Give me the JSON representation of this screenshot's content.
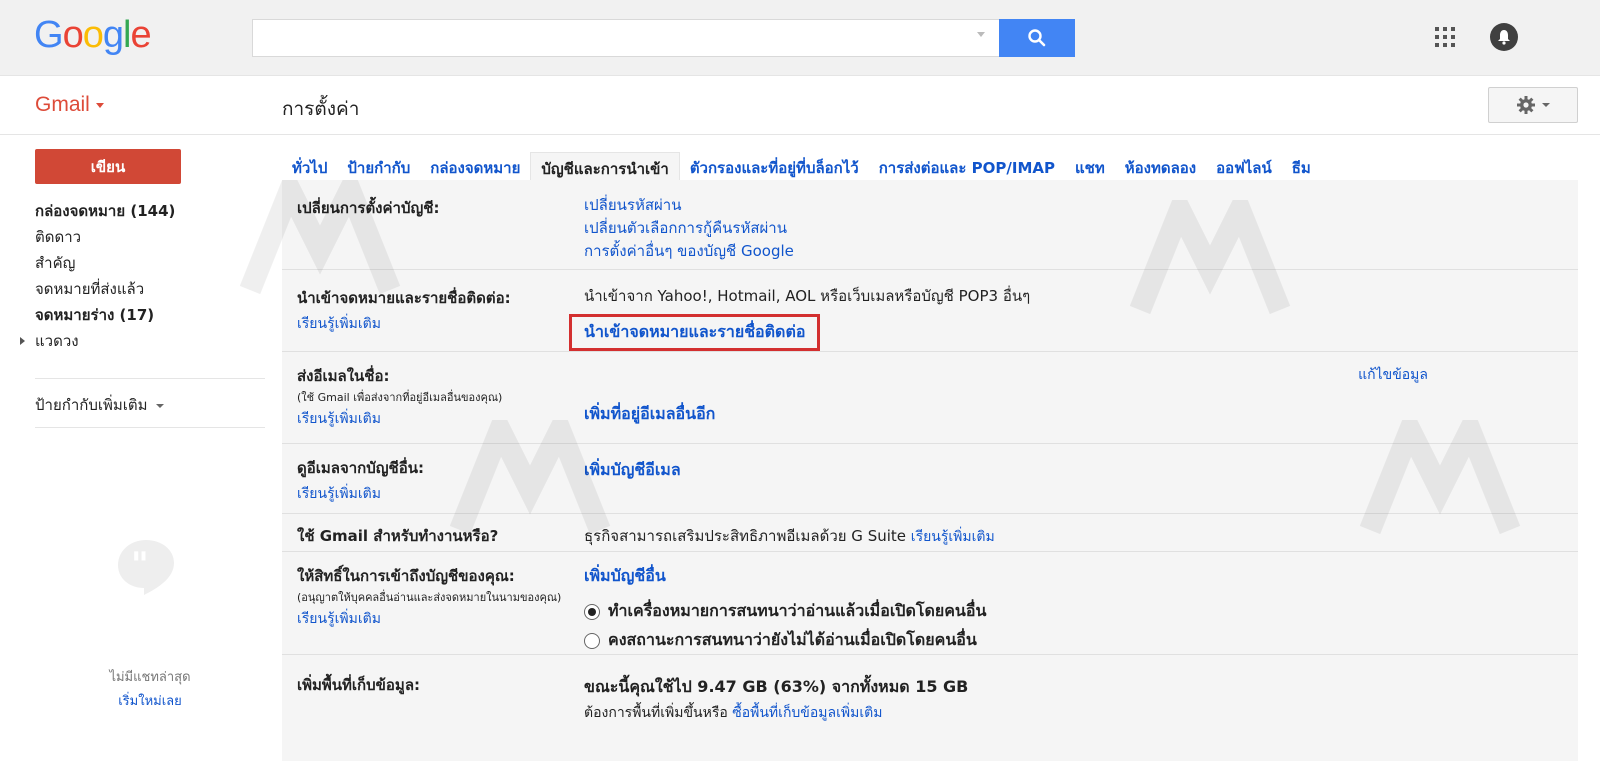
{
  "header": {
    "logo_letters": [
      {
        "ch": "G",
        "color": "#4285f4"
      },
      {
        "ch": "o",
        "color": "#ea4335"
      },
      {
        "ch": "o",
        "color": "#fbbc05"
      },
      {
        "ch": "g",
        "color": "#4285f4"
      },
      {
        "ch": "l",
        "color": "#34a853"
      },
      {
        "ch": "e",
        "color": "#ea4335"
      }
    ],
    "search_value": "",
    "search_button_color": "#4285f4"
  },
  "subbar": {
    "app_label": "Gmail",
    "page_title": "การตั้งค่า"
  },
  "sidebar": {
    "compose_label": "เขียน",
    "items": [
      {
        "label": "กล่องจดหมาย (144)",
        "bold": true
      },
      {
        "label": "ติดดาว",
        "bold": false
      },
      {
        "label": "สำคัญ",
        "bold": false
      },
      {
        "label": "จดหมายที่ส่งแล้ว",
        "bold": false
      },
      {
        "label": "จดหมายร่าง (17)",
        "bold": true
      },
      {
        "label": "แวดวง",
        "bold": false
      }
    ],
    "more_labels": "ป้ายกำกับเพิ่มเติม",
    "no_recent_chats": "ไม่มีแชทล่าสุด",
    "start_new": "เริ่มใหม่เลย"
  },
  "tabs": [
    {
      "label": "ทั่วไป",
      "active": false
    },
    {
      "label": "ป้ายกำกับ",
      "active": false
    },
    {
      "label": "กล่องจดหมาย",
      "active": false
    },
    {
      "label": "บัญชีและการนำเข้า",
      "active": true
    },
    {
      "label": "ตัวกรองและที่อยู่ที่บล็อกไว้",
      "active": false
    },
    {
      "label": "การส่งต่อและ POP/IMAP",
      "active": false
    },
    {
      "label": "แชท",
      "active": false
    },
    {
      "label": "ห้องทดลอง",
      "active": false
    },
    {
      "label": "ออฟไลน์",
      "active": false
    },
    {
      "label": "ธีม",
      "active": false
    }
  ],
  "settings": {
    "change_account": {
      "title": "เปลี่ยนการตั้งค่าบัญชี:",
      "links": [
        "เปลี่ยนรหัสผ่าน",
        "เปลี่ยนตัวเลือกการกู้คืนรหัสผ่าน",
        "การตั้งค่าอื่นๆ ของบัญชี Google"
      ]
    },
    "import": {
      "title": "นำเข้าจดหมายและรายชื่อติดต่อ:",
      "learn_more": "เรียนรู้เพิ่มเติม",
      "description": "นำเข้าจาก Yahoo!, Hotmail, AOL หรือเว็บเมลหรือบัญชี POP3 อื่นๆ",
      "action": "นำเข้าจดหมายและรายชื่อติดต่อ"
    },
    "send_as": {
      "title": "ส่งอีเมลในชื่อ:",
      "subtitle": "(ใช้ Gmail เพื่อส่งจากที่อยู่อีเมลอื่นของคุณ)",
      "learn_more": "เรียนรู้เพิ่มเติม",
      "edit": "แก้ไขข้อมูล",
      "action": "เพิ่มที่อยู่อีเมลอื่นอีก"
    },
    "check_mail": {
      "title": "ดูอีเมลจากบัญชีอื่น:",
      "learn_more": "เรียนรู้เพิ่มเติม",
      "action": "เพิ่มบัญชีอีเมล"
    },
    "work": {
      "title": "ใช้ Gmail สำหรับทำงานหรือ?",
      "description": "ธุรกิจสามารถเสริมประสิทธิภาพอีเมลด้วย G Suite",
      "learn_more": "เรียนรู้เพิ่มเติม"
    },
    "grant_access": {
      "title": "ให้สิทธิ์ในการเข้าถึงบัญชีของคุณ:",
      "subtitle": "(อนุญาตให้บุคคลอื่นอ่านและส่งจดหมายในนามของคุณ)",
      "learn_more": "เรียนรู้เพิ่มเติม",
      "action": "เพิ่มบัญชีอื่น",
      "option_read": "ทำเครื่องหมายการสนทนาว่าอ่านแล้วเมื่อเปิดโดยคนอื่น",
      "option_unread": "คงสถานะการสนทนาว่ายังไม่ได้อ่านเมื่อเปิดโดยคนอื่น",
      "selected": "read"
    },
    "storage": {
      "title": "เพิ่มพื้นที่เก็บข้อมูล:",
      "usage": "ขณะนี้คุณใช้ไป 9.47 GB (63%) จากทั้งหมด 15 GB",
      "used_percent": 63,
      "prompt": "ต้องการพื้นที่เพิ่มขึ้นหรือ",
      "buy_link": "ซื้อพื้นที่เก็บข้อมูลเพิ่มเติม"
    }
  },
  "colors": {
    "link": "#1155cc",
    "compose": "#d14836",
    "highlight_border": "#d32f2f"
  }
}
